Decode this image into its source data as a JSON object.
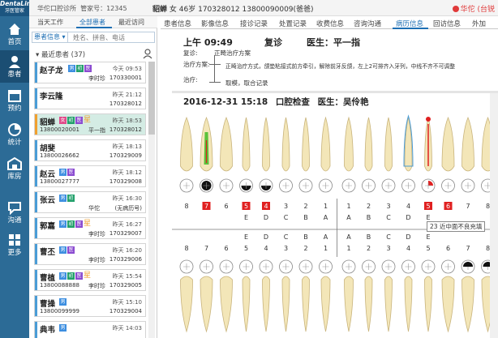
{
  "app": {
    "logo_text": "DentaLink",
    "logo_sub": "牙医管家",
    "clinic": "华佗口腔诊所",
    "account": "管家号：12345",
    "current_doctor": "华佗 (台锐"
  },
  "nav": [
    {
      "label": "首页",
      "icon": "home-icon"
    },
    {
      "label": "患者",
      "icon": "user-icon"
    },
    {
      "label": "预约",
      "icon": "calendar-icon"
    },
    {
      "label": "统计",
      "icon": "pie-chart-icon"
    },
    {
      "label": "库房",
      "icon": "warehouse-icon"
    },
    {
      "label": "沟通",
      "icon": "chat-icon"
    },
    {
      "label": "更多",
      "icon": "grid-icon"
    }
  ],
  "patient_header": {
    "name": "貂蝉",
    "sex": "女",
    "age": "46岁",
    "mrn": "170328012",
    "phone": "13800090009(爸爸)"
  },
  "patient_panel": {
    "tabs": [
      "当天工作",
      "全部患者",
      "最近访问"
    ],
    "active_tab": 1,
    "search_select": "患者信息",
    "search_placeholder": "姓名、拼音、电话",
    "group_title": "最近患者 (37)"
  },
  "patients": [
    {
      "name": "赵子龙",
      "time": "今天 09:53",
      "phone": "",
      "doctor": "李时珍",
      "mrn": "170330001",
      "tags": [
        "男",
        "初",
        "医"
      ],
      "female": false,
      "selected": false
    },
    {
      "name": "李云隆",
      "time": "昨天 21:12",
      "phone": "",
      "doctor": "",
      "mrn": "170328012",
      "tags": [],
      "female": false,
      "selected": false
    },
    {
      "name": "貂蝉",
      "time": "昨天 18:53",
      "phone": "13800020001",
      "doctor": "平一指",
      "mrn": "170328012",
      "tags": [
        "女",
        "初",
        "医",
        "星"
      ],
      "female": true,
      "selected": true
    },
    {
      "name": "胡斐",
      "time": "昨天 18:13",
      "phone": "13800026662",
      "doctor": "",
      "mrn": "170329009",
      "tags": [],
      "female": false,
      "selected": false
    },
    {
      "name": "赵云",
      "time": "昨天 18:12",
      "phone": "13800027777",
      "doctor": "",
      "mrn": "170329008",
      "tags": [
        "男",
        "医"
      ],
      "female": false,
      "selected": false
    },
    {
      "name": "张云",
      "time": "昨天 16:30",
      "phone": "",
      "doctor": "华佗",
      "mrn": "(无病历号)",
      "tags": [
        "男",
        "初"
      ],
      "female": false,
      "selected": false
    },
    {
      "name": "郭嘉",
      "time": "昨天 16:27",
      "phone": "",
      "doctor": "李时珍",
      "mrn": "170329007",
      "tags": [
        "男",
        "初",
        "医",
        "星"
      ],
      "female": false,
      "selected": false
    },
    {
      "name": "曹丕",
      "time": "昨天 16:20",
      "phone": "",
      "doctor": "李时珍",
      "mrn": "170329006",
      "tags": [
        "男",
        "医"
      ],
      "female": false,
      "selected": false
    },
    {
      "name": "曹植",
      "time": "昨天 15:54",
      "phone": "13800088888",
      "doctor": "李时珍",
      "mrn": "170329005",
      "tags": [
        "男",
        "初",
        "医",
        "星"
      ],
      "female": false,
      "selected": false
    },
    {
      "name": "曹操",
      "time": "昨天 15:10",
      "phone": "13800099999",
      "doctor": "",
      "mrn": "170329004",
      "tags": [
        "男"
      ],
      "female": false,
      "selected": false
    },
    {
      "name": "典韦",
      "time": "昨天 14:03",
      "phone": "",
      "doctor": "",
      "mrn": "",
      "tags": [
        "男"
      ],
      "female": false,
      "selected": false
    }
  ],
  "record_tabs": [
    "患者信息",
    "影像信息",
    "接诊记录",
    "处置记录",
    "收费信息",
    "咨询沟通",
    "病历信息",
    "回访信息",
    "外加"
  ],
  "active_record_tab": 6,
  "record1": {
    "time": "上午 09:49",
    "visit": "复诊",
    "doctor": "医生：平一指",
    "rows": [
      {
        "label": "复诊:",
        "value": "正畸治疗方案"
      },
      {
        "label": "治疗方案:",
        "value": "正畸治疗方式，颌垫粘接式前方牵引，解除前牙反颌，左上2可排齐入牙列，中线不齐不可调整"
      },
      {
        "label": "治疗:",
        "value": "取模，取合记录"
      }
    ]
  },
  "record2": {
    "date": "2016-12-31 15:18",
    "title": "口腔检查",
    "doctor": "医生：吴伶艳"
  },
  "tooth_chart": {
    "upper_labels": [
      "8",
      "7",
      "6",
      "5",
      "4",
      "3",
      "2",
      "1",
      "1",
      "2",
      "3",
      "4",
      "5",
      "6",
      "7",
      "8"
    ],
    "upper_letters": [
      "",
      "",
      "",
      "E",
      "D",
      "C",
      "B",
      "A",
      "A",
      "B",
      "C",
      "D",
      "E",
      "",
      "",
      ""
    ],
    "lower_letters": [
      "",
      "",
      "",
      "E",
      "D",
      "C",
      "B",
      "A",
      "A",
      "B",
      "C",
      "D",
      "E",
      "",
      "",
      ""
    ],
    "lower_labels": [
      "8",
      "7",
      "6",
      "5",
      "4",
      "3",
      "2",
      "1",
      "1",
      "2",
      "3",
      "4",
      "5",
      "6",
      "7",
      "8"
    ],
    "flag_color": "#e02020",
    "upper_flagged": [
      1,
      3,
      4,
      12,
      13
    ],
    "lower_flagged": []
  },
  "tooltip": "23 近中面不良充填"
}
